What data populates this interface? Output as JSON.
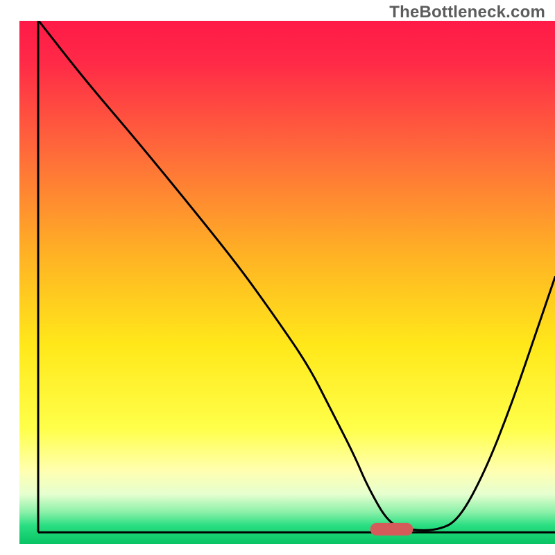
{
  "watermark": "TheBottleneck.com",
  "chart_data": {
    "type": "line",
    "title": "",
    "xlabel": "",
    "ylabel": "",
    "xlim": [
      0,
      100
    ],
    "ylim": [
      0,
      100
    ],
    "background_gradient": {
      "stops": [
        {
          "offset": 0.0,
          "color": "#ff1a47"
        },
        {
          "offset": 0.08,
          "color": "#ff2a47"
        },
        {
          "offset": 0.25,
          "color": "#ff6a3a"
        },
        {
          "offset": 0.45,
          "color": "#ffb324"
        },
        {
          "offset": 0.62,
          "color": "#ffe81a"
        },
        {
          "offset": 0.78,
          "color": "#ffff4a"
        },
        {
          "offset": 0.86,
          "color": "#ffffb0"
        },
        {
          "offset": 0.905,
          "color": "#e6ffd0"
        },
        {
          "offset": 0.94,
          "color": "#88f0a8"
        },
        {
          "offset": 0.965,
          "color": "#29de82"
        },
        {
          "offset": 1.0,
          "color": "#07c463"
        }
      ]
    },
    "series": [
      {
        "name": "curve",
        "color": "#000000",
        "x": [
          3.6,
          12,
          22,
          32,
          41,
          48,
          54,
          58,
          62.5,
          65,
          69,
          73,
          78,
          82,
          87,
          92,
          97,
          100
        ],
        "values": [
          100,
          89,
          77,
          64.5,
          53,
          43,
          34,
          26,
          17,
          11,
          3.8,
          2.6,
          2.6,
          4.5,
          14,
          27,
          42,
          51
        ]
      }
    ],
    "marker": {
      "name": "optimum-marker",
      "color": "#d55b5b",
      "x_range": [
        65.5,
        73.5
      ],
      "y": 2.8,
      "thickness": 2.4
    },
    "baseline": {
      "color": "#000000",
      "y": 2.2,
      "x_range": [
        3.5,
        100
      ]
    },
    "left_border": {
      "color": "#000000",
      "x": 3.5,
      "y_range": [
        2.2,
        100
      ]
    }
  }
}
